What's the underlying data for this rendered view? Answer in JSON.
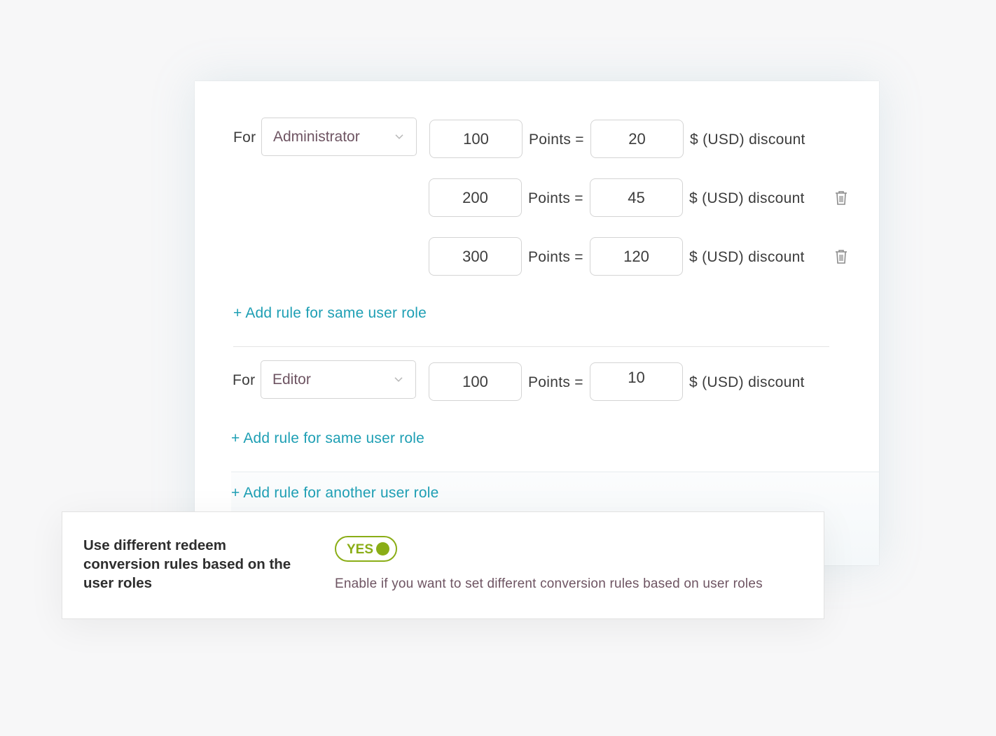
{
  "rules": {
    "for_label": "For",
    "points_label": "Points =",
    "discount_label": "$ (USD) discount",
    "groups": [
      {
        "role": "Administrator",
        "rows": [
          {
            "points": "100",
            "discount": "20"
          },
          {
            "points": "200",
            "discount": "45"
          },
          {
            "points": "300",
            "discount": "120"
          }
        ],
        "add_same_label": "+ Add rule for same user role"
      },
      {
        "role": "Editor",
        "rows": [
          {
            "points": "100",
            "discount": "10"
          }
        ],
        "add_same_label": "+ Add rule for same user role"
      }
    ],
    "add_another_label": "+ Add rule for another user role"
  },
  "settings": {
    "title": "Use different redeem conversion rules based on the user roles",
    "toggle_label": "YES",
    "toggle_on": true,
    "description": "Enable if you want to set different conversion rules based on user roles"
  },
  "colors": {
    "link": "#1e9fb4",
    "toggle": "#8aad16",
    "muted_text": "#6e5462"
  },
  "icons": {
    "delete": "trash-icon",
    "dropdown": "chevron-down-icon"
  }
}
